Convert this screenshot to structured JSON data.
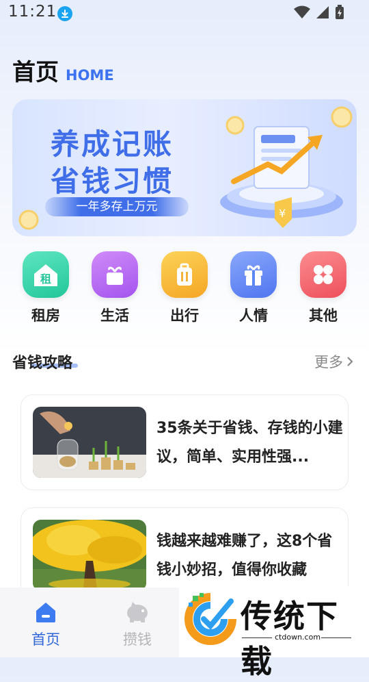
{
  "status": {
    "time": "11:21"
  },
  "header": {
    "title": "首页",
    "subtitle": "HOME"
  },
  "banner": {
    "line1": "养成记账",
    "line2": "省钱习惯",
    "sub": "一年多存上万元"
  },
  "categories": [
    {
      "label": "租房",
      "icon": "house-icon",
      "glyph": "租",
      "color": "#2fd3a3"
    },
    {
      "label": "生活",
      "icon": "gift-pot-icon",
      "color": "#b469f0"
    },
    {
      "label": "出行",
      "icon": "suitcase-icon",
      "color": "#f7b731"
    },
    {
      "label": "人情",
      "icon": "gift-icon",
      "color": "#5b86f5"
    },
    {
      "label": "其他",
      "icon": "clover-icon",
      "color": "#f2606a"
    }
  ],
  "section": {
    "title": "省钱攻略",
    "more": "更多"
  },
  "articles": [
    {
      "title": "35条关于省钱、存钱的小建议，简单、实用性强..."
    },
    {
      "title": "钱越来越难赚了，这8个省钱小妙招，值得你收藏"
    }
  ],
  "tabs": [
    {
      "label": "首页",
      "icon": "home-icon",
      "active": true
    },
    {
      "label": "攒钱",
      "icon": "piggy-bank-icon",
      "active": false
    }
  ],
  "watermark": {
    "text": "传统下载",
    "url": "ctdown.com"
  }
}
